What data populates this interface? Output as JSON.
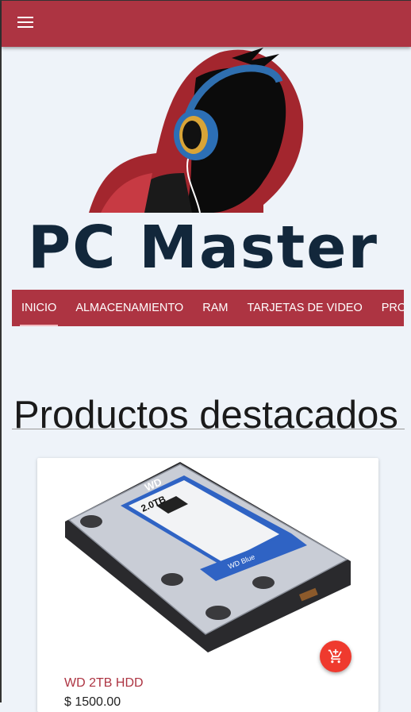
{
  "brand": {
    "name": "PC Master"
  },
  "navbar": {
    "items": [
      {
        "label": "INICIO",
        "active": true
      },
      {
        "label": "ALMACENAMIENTO"
      },
      {
        "label": "RAM"
      },
      {
        "label": "TARJETAS DE VIDEO"
      },
      {
        "label": "PROCESADORES"
      }
    ]
  },
  "main": {
    "section_title": "Productos destacados"
  },
  "product": {
    "name": "WD 2TB HDD",
    "price": "$ 1500.00",
    "label_brand": "WD",
    "label_capacity": "2.0TB",
    "label_line": "WD Blue"
  },
  "colors": {
    "accent": "#ad3442",
    "fab": "#ef3a2e",
    "brand_text": "#12273b",
    "background": "#eef3f9"
  },
  "icons": {
    "menu": "menu-icon",
    "cart": "add-shopping-cart-icon",
    "logo": "hooded-gamer-headphones-logo"
  }
}
